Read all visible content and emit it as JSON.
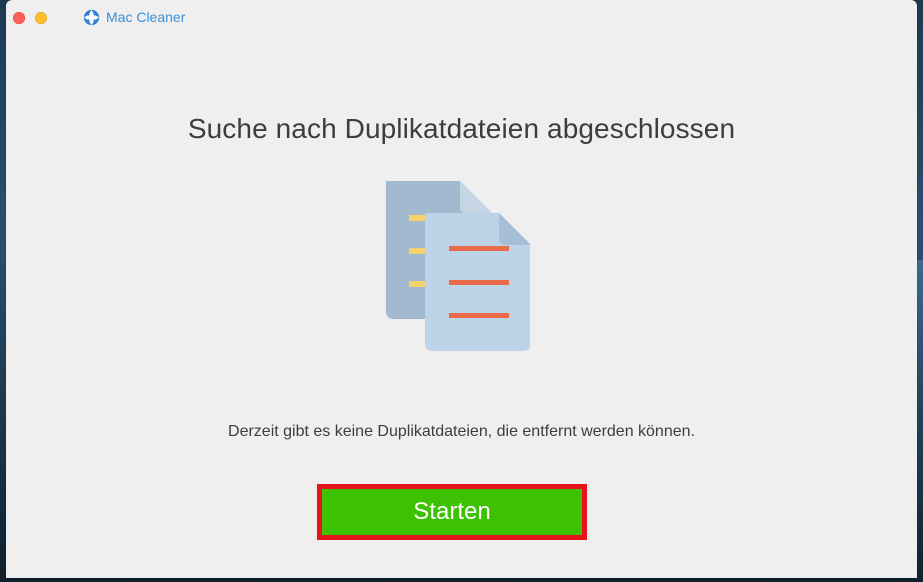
{
  "app": {
    "name": "Mac Cleaner",
    "logo_icon": "mac-cleaner-logo-icon"
  },
  "window_controls": {
    "close_color": "#fe5f57",
    "minimize_color": "#febc2e"
  },
  "main": {
    "heading": "Suche nach Duplikatdateien abgeschlossen",
    "illustration_icon": "duplicate-documents-icon",
    "message": "Derzeit gibt es keine Duplikatdateien, die entfernt werden können.",
    "start_button_label": "Starten"
  },
  "colors": {
    "button_fill": "#3ec103",
    "button_highlight_border": "#e8121a",
    "brand_blue": "#3a8fd6"
  }
}
